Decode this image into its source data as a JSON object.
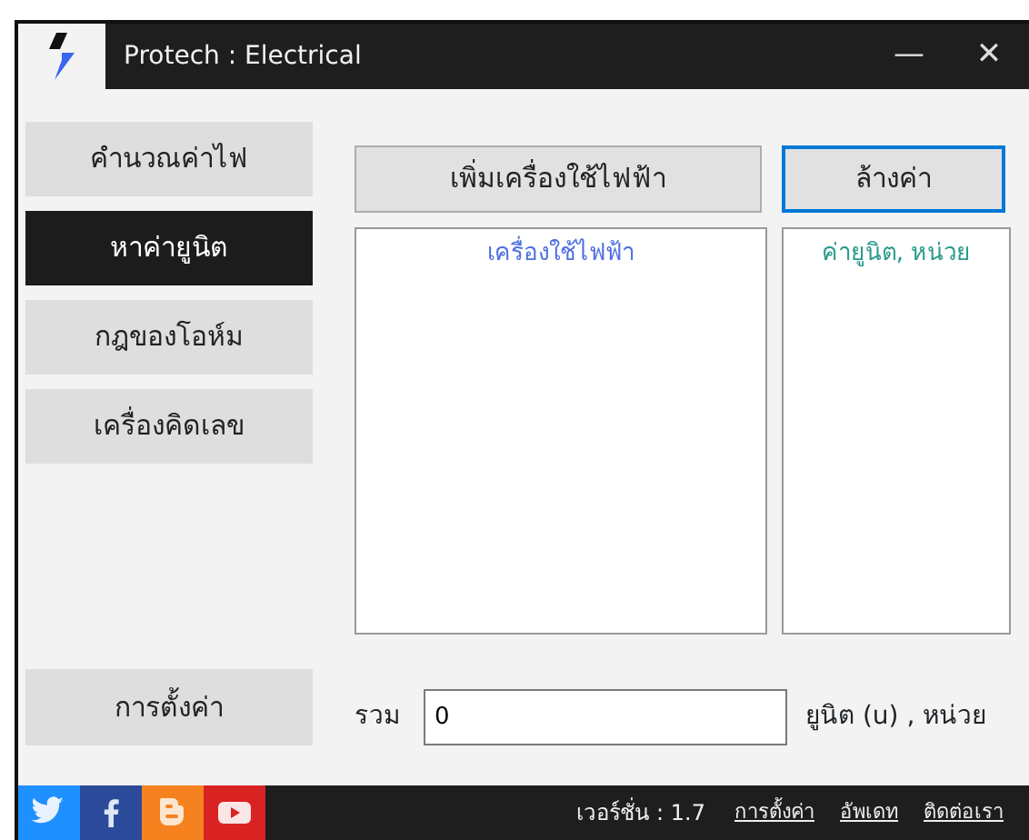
{
  "window": {
    "title": "Protech : Electrical",
    "controls": [
      "—",
      "✕"
    ]
  },
  "sidebar": {
    "items": [
      {
        "label": "คำนวณค่าไฟ",
        "selected": false
      },
      {
        "label": "หาค่ายูนิต",
        "selected": true
      },
      {
        "label": "กฎของโอห์ม",
        "selected": false
      },
      {
        "label": "เครื่องคิดเลข",
        "selected": false
      }
    ],
    "settings_button": "การตั้งค่า"
  },
  "buttons": [
    {
      "label": "เพิ่มเครื่องใช้ไฟฟ้า",
      "focused": false
    },
    {
      "label": "ล้างค่า",
      "focused": true
    }
  ],
  "lists": [
    {
      "header": "เครื่องใช้ไฟฟ้า",
      "color": "#4f6fe0"
    },
    {
      "header": "ค่ายูนิต, หน่วย",
      "color": "#2a9a8a"
    }
  ],
  "total": {
    "label": "รวม",
    "value": "0",
    "unit": "ยูนิต (u) , หน่วย"
  },
  "footer": {
    "social": [
      {
        "kind": "twitter",
        "color": "#1e90ff"
      },
      {
        "kind": "facebook",
        "color": "#2c4a9a"
      },
      {
        "kind": "blogger",
        "color": "#f5821f"
      },
      {
        "kind": "youtube",
        "color": "#d92323"
      }
    ],
    "version": "เวอร์ชั่น : 1.7",
    "links": [
      "การตั้งค่า",
      "อัพเดท",
      "ติดต่อเรา"
    ]
  }
}
